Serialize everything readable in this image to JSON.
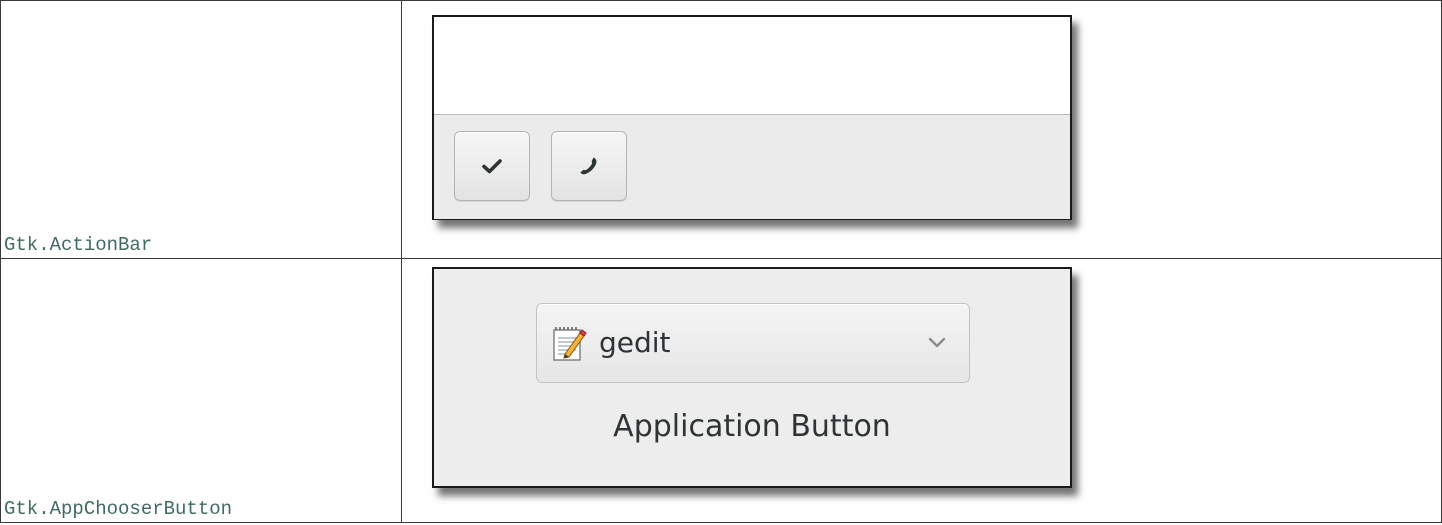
{
  "rows": [
    {
      "class_name": "Gtk.ActionBar",
      "action_bar": {
        "buttons": [
          {
            "icon": "checkmark-icon"
          },
          {
            "icon": "phone-icon"
          }
        ]
      }
    },
    {
      "class_name": "Gtk.AppChooserButton",
      "app_chooser": {
        "icon": "gedit-app-icon",
        "app_name": "gedit",
        "dropdown_icon": "chevron-down-icon",
        "caption": "Application Button"
      }
    }
  ],
  "colors": {
    "class_name_text": "#3f6b62",
    "border": "#3a3a3a",
    "window_bg": "#ededed"
  }
}
